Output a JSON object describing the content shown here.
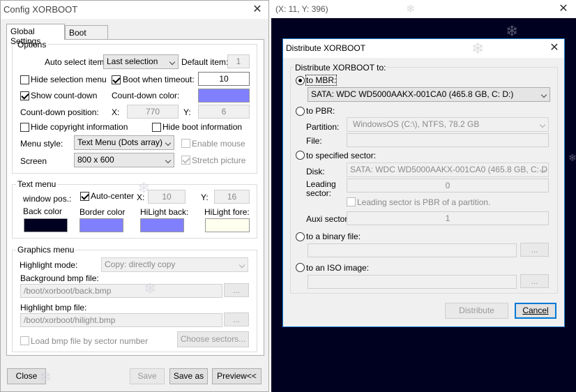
{
  "left": {
    "title": "Config XORBOOT",
    "tabs": [
      "Global Settings",
      "Boot items"
    ],
    "options": {
      "legend": "Options",
      "auto_select_label": "Auto select item:",
      "auto_select_value": "Last selection",
      "default_item_label": "Default item:",
      "default_item_value": "1",
      "hide_selection_menu": "Hide selection menu",
      "boot_when_timeout": "Boot when timeout:",
      "timeout_value": "10",
      "show_count_down": "Show count-down",
      "count_down_color": "Count-down color:",
      "count_down_color_hex": "#8080ff",
      "count_down_position": "Count-down position:",
      "x_label": "X:",
      "x_value": "770",
      "y_label": "Y:",
      "y_value": "6",
      "hide_copyright": "Hide copyright information",
      "hide_boot_info": "Hide boot information",
      "menu_style_label": "Menu style:",
      "menu_style_value": "Text Menu (Dots array)",
      "enable_mouse": "Enable mouse",
      "screen_label": "Screen",
      "screen_value": "800 x 600",
      "stretch_picture": "Stretch picture"
    },
    "text_menu": {
      "legend": "Text menu",
      "window_pos": "window pos.:",
      "auto_center": "Auto-center",
      "x_label": "X:",
      "x_value": "10",
      "y_label": "Y:",
      "y_value": "16",
      "back_color": "Back color",
      "back_color_hex": "#000020",
      "border_color": "Border color",
      "border_color_hex": "#8080ff",
      "hilight_back": "HiLight back:",
      "hilight_back_hex": "#8080ff",
      "hilight_fore": "HiLight fore:",
      "hilight_fore_hex": "#ffffee"
    },
    "graphics_menu": {
      "legend": "Graphics menu",
      "highlight_mode_label": "Highlight mode:",
      "highlight_mode_value": "Copy: directly copy",
      "background_bmp_label": "Background bmp file:",
      "background_bmp_value": "/boot/xorboot/back.bmp",
      "highlight_bmp_label": "Highlight bmp file:",
      "highlight_bmp_value": "/boot/xorboot/hilight.bmp",
      "browse": "...",
      "load_by_sector": "Load bmp file by sector number",
      "choose_sectors": "Choose sectors..."
    },
    "buttons": {
      "close": "Close",
      "save": "Save",
      "save_as": "Save as",
      "preview": "Preview<<"
    }
  },
  "right": {
    "title": "(X: 11, Y: 396)"
  },
  "dialog": {
    "title": "Distribute XORBOOT",
    "group_label": "Distribute XORBOOT to:",
    "to_mbr": "to MBR:",
    "mbr_disk": "SATA: WDC WD5000AAKX-001CA0 (465.8 GB, C: D:)",
    "to_pbr": "to PBR:",
    "partition_label": "Partition:",
    "partition_value": "WindowsOS (C:\\),  NTFS,  78.2 GB",
    "file_label": "File:",
    "to_sector": "to specified sector:",
    "disk_label": "Disk:",
    "disk_value": "SATA: WDC WD5000AAKX-001CA0 (465.8 GB, C: D:)",
    "leading_sector_label": "Leading sector:",
    "leading_sector_value": "0",
    "leading_is_pbr": "Leading sector is PBR of a partition.",
    "auxi_sector_label": "Auxi sector",
    "auxi_sector_value": "1",
    "to_binary": "to a binary file:",
    "to_iso": "to an ISO image:",
    "browse": "...",
    "distribute": "Distribute",
    "cancel": "Cancel"
  }
}
